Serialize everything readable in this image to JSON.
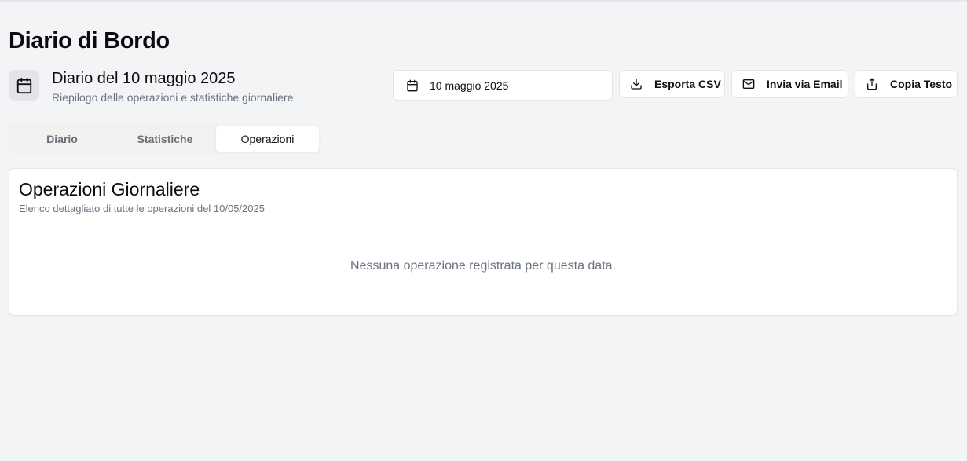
{
  "page": {
    "title": "Diario di Bordo"
  },
  "header": {
    "icon": "calendar-icon",
    "title": "Diario del 10 maggio 2025",
    "subtitle": "Riepilogo delle operazioni e statistiche giornaliere"
  },
  "toolbar": {
    "date_value": "10 maggio 2025",
    "export_csv_label": "Esporta CSV",
    "email_label": "Invia via Email",
    "copy_label": "Copia Testo"
  },
  "tabs": [
    {
      "label": "Diario",
      "active": false
    },
    {
      "label": "Statistiche",
      "active": false
    },
    {
      "label": "Operazioni",
      "active": true
    }
  ],
  "card": {
    "title": "Operazioni Giornaliere",
    "subtitle": "Elenco dettagliato di tutte le operazioni del 10/05/2025",
    "empty_message": "Nessuna operazione registrata per questa data."
  },
  "colors": {
    "background": "#f3f4f6",
    "card": "#ffffff",
    "muted_text": "#6b7280",
    "badge": "#e3e4e8"
  }
}
